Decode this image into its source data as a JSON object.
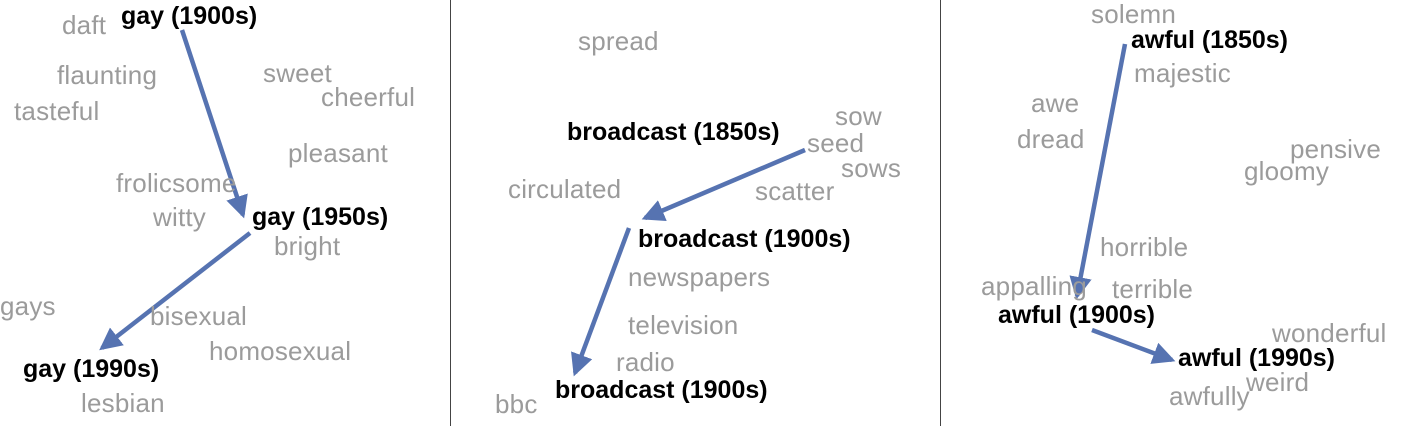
{
  "panels": [
    {
      "focus": [
        "gay (1900s)",
        "gay (1950s)",
        "gay (1990s)"
      ],
      "neighbors": [
        "daft",
        "flaunting",
        "sweet",
        "cheerful",
        "tasteful",
        "pleasant",
        "frolicsome",
        "witty",
        "bright",
        "gays",
        "bisexual",
        "homosexual",
        "lesbian"
      ]
    },
    {
      "focus": [
        "broadcast (1850s)",
        "broadcast (1900s)",
        "broadcast (1900s)"
      ],
      "neighbors": [
        "spread",
        "sow",
        "seed",
        "sows",
        "circulated",
        "scatter",
        "newspapers",
        "television",
        "radio",
        "bbc"
      ]
    },
    {
      "focus": [
        "awful (1850s)",
        "awful (1900s)",
        "awful (1990s)"
      ],
      "neighbors": [
        "solemn",
        "majestic",
        "awe",
        "dread",
        "pensive",
        "gloomy",
        "horrible",
        "appalling",
        "terrible",
        "wonderful",
        "weird",
        "awfully"
      ]
    }
  ],
  "colors": {
    "arrow": "#5673b1",
    "neighbor_text": "#9b9b9b",
    "focus_text": "#000000"
  }
}
